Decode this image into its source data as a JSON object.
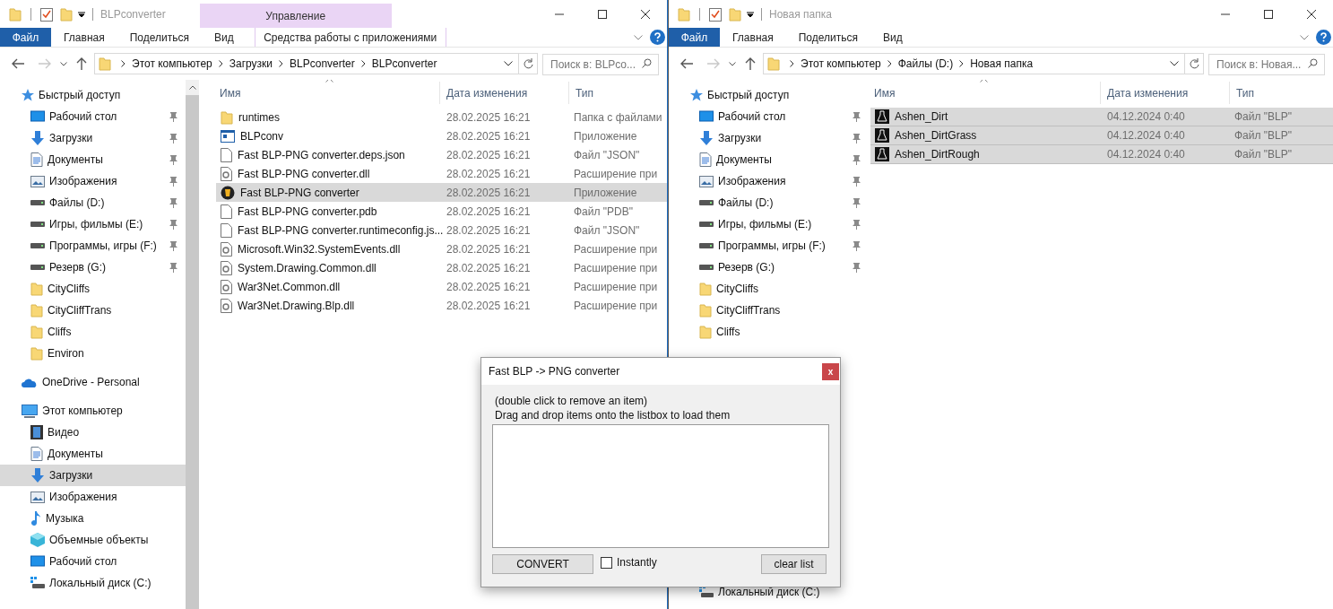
{
  "windows": [
    {
      "title": "BLPconverter",
      "active": true,
      "contextual_header": "Управление",
      "ribbon_tabs": [
        {
          "label": "Файл",
          "kind": "file"
        },
        {
          "label": "Главная",
          "kind": "tab"
        },
        {
          "label": "Поделиться",
          "kind": "tab"
        },
        {
          "label": "Вид",
          "kind": "tab"
        },
        {
          "label": "Средства работы с приложениями",
          "kind": "contextual"
        }
      ],
      "breadcrumb": [
        "Этот компьютер",
        "Загрузки",
        "BLPconverter",
        "BLPconverter"
      ],
      "search": {
        "placeholder": "Поиск в: BLPco..."
      },
      "sidebar": [
        {
          "label": "Быстрый доступ",
          "kind": "star",
          "selected": false,
          "children": [
            {
              "label": "Рабочий стол",
              "kind": "desktop",
              "pinned": true,
              "selected": false
            },
            {
              "label": "Загрузки",
              "kind": "download",
              "pinned": true,
              "selected": false
            },
            {
              "label": "Документы",
              "kind": "docs",
              "pinned": true,
              "selected": false
            },
            {
              "label": "Изображения",
              "kind": "images",
              "pinned": true,
              "selected": false
            },
            {
              "label": "Файлы (D:)",
              "kind": "drive",
              "pinned": true,
              "selected": false
            },
            {
              "label": "Игры, фильмы (E:)",
              "kind": "drive",
              "pinned": true,
              "selected": false
            },
            {
              "label": "Программы, игры (F:)",
              "kind": "drive",
              "pinned": true,
              "selected": false
            },
            {
              "label": "Резерв (G:)",
              "kind": "drive",
              "pinned": true,
              "selected": false
            },
            {
              "label": "CityCliffs",
              "kind": "folder",
              "pinned": false,
              "selected": false
            },
            {
              "label": "CityCliffTrans",
              "kind": "folder",
              "pinned": false,
              "selected": false
            },
            {
              "label": "Cliffs",
              "kind": "folder",
              "pinned": false,
              "selected": false
            },
            {
              "label": "Environ",
              "kind": "folder",
              "pinned": false,
              "selected": false
            }
          ]
        },
        {
          "label": "OneDrive - Personal",
          "kind": "cloud",
          "selected": false
        },
        {
          "label": "Этот компьютер",
          "kind": "pc",
          "selected": false,
          "children": [
            {
              "label": "Видео",
              "kind": "video",
              "pinned": false,
              "selected": false
            },
            {
              "label": "Документы",
              "kind": "docs",
              "pinned": false,
              "selected": false
            },
            {
              "label": "Загрузки",
              "kind": "download",
              "pinned": false,
              "selected": true
            },
            {
              "label": "Изображения",
              "kind": "images",
              "pinned": false,
              "selected": false
            },
            {
              "label": "Музыка",
              "kind": "music",
              "pinned": false,
              "selected": false
            },
            {
              "label": "Объемные объекты",
              "kind": "cube",
              "pinned": false,
              "selected": false
            },
            {
              "label": "Рабочий стол",
              "kind": "desktop",
              "pinned": false,
              "selected": false
            },
            {
              "label": "Локальный диск (C:)",
              "kind": "localdisk",
              "pinned": false,
              "selected": false
            }
          ]
        }
      ],
      "columns": [
        "Имя",
        "Дата изменения",
        "Тип"
      ],
      "rows": [
        {
          "name": "runtimes",
          "date": "28.02.2025 16:21",
          "type": "Папка с файлами",
          "kind": "folder",
          "selected": false
        },
        {
          "name": "BLPconv",
          "date": "28.02.2025 16:21",
          "type": "Приложение",
          "kind": "app",
          "selected": false
        },
        {
          "name": "Fast BLP-PNG converter.deps.json",
          "date": "28.02.2025 16:21",
          "type": "Файл \"JSON\"",
          "kind": "doc",
          "selected": false
        },
        {
          "name": "Fast BLP-PNG converter.dll",
          "date": "28.02.2025 16:21",
          "type": "Расширение при",
          "kind": "dll",
          "selected": false
        },
        {
          "name": "Fast BLP-PNG converter",
          "date": "28.02.2025 16:21",
          "type": "Приложение",
          "kind": "exe",
          "selected": true
        },
        {
          "name": "Fast BLP-PNG converter.pdb",
          "date": "28.02.2025 16:21",
          "type": "Файл \"PDB\"",
          "kind": "doc",
          "selected": false
        },
        {
          "name": "Fast BLP-PNG converter.runtimeconfig.js...",
          "date": "28.02.2025 16:21",
          "type": "Файл \"JSON\"",
          "kind": "doc",
          "selected": false
        },
        {
          "name": "Microsoft.Win32.SystemEvents.dll",
          "date": "28.02.2025 16:21",
          "type": "Расширение при",
          "kind": "dll",
          "selected": false
        },
        {
          "name": "System.Drawing.Common.dll",
          "date": "28.02.2025 16:21",
          "type": "Расширение при",
          "kind": "dll",
          "selected": false
        },
        {
          "name": "War3Net.Common.dll",
          "date": "28.02.2025 16:21",
          "type": "Расширение при",
          "kind": "dll",
          "selected": false
        },
        {
          "name": "War3Net.Drawing.Blp.dll",
          "date": "28.02.2025 16:21",
          "type": "Расширение при",
          "kind": "dll",
          "selected": false
        }
      ]
    },
    {
      "title": "Новая папка",
      "active": false,
      "ribbon_tabs": [
        {
          "label": "Файл",
          "kind": "file"
        },
        {
          "label": "Главная",
          "kind": "tab"
        },
        {
          "label": "Поделиться",
          "kind": "tab"
        },
        {
          "label": "Вид",
          "kind": "tab"
        }
      ],
      "breadcrumb": [
        "Этот компьютер",
        "Файлы (D:)",
        "Новая папка"
      ],
      "search": {
        "placeholder": "Поиск в: Новая..."
      },
      "sidebar": [
        {
          "label": "Быстрый доступ",
          "kind": "star",
          "selected": false,
          "children": [
            {
              "label": "Рабочий стол",
              "kind": "desktop",
              "pinned": true,
              "selected": false
            },
            {
              "label": "Загрузки",
              "kind": "download",
              "pinned": true,
              "selected": false
            },
            {
              "label": "Документы",
              "kind": "docs",
              "pinned": true,
              "selected": false
            },
            {
              "label": "Изображения",
              "kind": "images",
              "pinned": true,
              "selected": false
            },
            {
              "label": "Файлы (D:)",
              "kind": "drive",
              "pinned": true,
              "selected": false
            },
            {
              "label": "Игры, фильмы (E:)",
              "kind": "drive",
              "pinned": true,
              "selected": false
            },
            {
              "label": "Программы, игры (F:)",
              "kind": "drive",
              "pinned": true,
              "selected": false
            },
            {
              "label": "Резерв (G:)",
              "kind": "drive",
              "pinned": true,
              "selected": false
            },
            {
              "label": "CityCliffs",
              "kind": "folder",
              "pinned": false,
              "selected": false
            },
            {
              "label": "CityCliffTrans",
              "kind": "folder",
              "pinned": false,
              "selected": false
            },
            {
              "label": "Cliffs",
              "kind": "folder",
              "pinned": false,
              "selected": false
            }
          ]
        }
      ],
      "sidebar_bottom": [
        {
          "label": "Локальный диск (C:)",
          "kind": "localdisk",
          "selected": false
        }
      ],
      "columns": [
        "Имя",
        "Дата изменения",
        "Тип"
      ],
      "rows": [
        {
          "name": "Ashen_Dirt",
          "date": "04.12.2024 0:40",
          "type": "Файл \"BLP\"",
          "kind": "blp",
          "selected": true
        },
        {
          "name": "Ashen_DirtGrass",
          "date": "04.12.2024 0:40",
          "type": "Файл \"BLP\"",
          "kind": "blp",
          "selected": true
        },
        {
          "name": "Ashen_DirtRough",
          "date": "04.12.2024 0:40",
          "type": "Файл \"BLP\"",
          "kind": "blp",
          "selected": true
        }
      ]
    }
  ],
  "dialog": {
    "title": "Fast BLP -> PNG converter",
    "close": "x",
    "hint": "(double click to remove an item)",
    "instructions": "Drag and drop items onto the listbox to load them",
    "convert": "CONVERT",
    "instantly": {
      "label": "Instantly",
      "checked": false
    },
    "clear": "clear list"
  }
}
